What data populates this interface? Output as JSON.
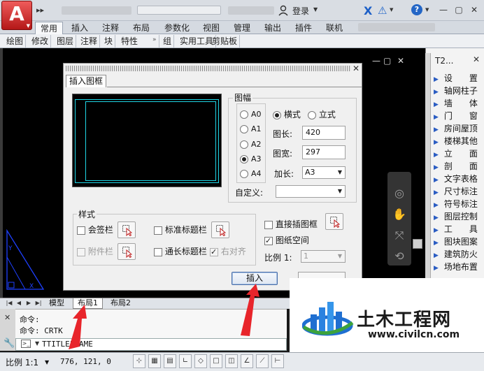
{
  "titlebar": {
    "qat_more": "▸▸",
    "login": "登录",
    "window_buttons": {
      "min": "—",
      "max": "▢",
      "close": "✕"
    }
  },
  "ribbon": {
    "tabs": [
      "常用",
      "插入",
      "注释",
      "布局",
      "参数化",
      "视图",
      "管理",
      "输出",
      "插件",
      "联机"
    ],
    "active_tab": 0,
    "panels": [
      "绘图",
      "修改",
      "图层",
      "注释",
      "块",
      "特性",
      "组",
      "实用工具",
      "剪贴板"
    ]
  },
  "drawing_window": {
    "min": "—",
    "max": "▢",
    "close": "✕"
  },
  "palette": {
    "title": "T2...",
    "close": "✕",
    "items": [
      "设　　置",
      "轴网柱子",
      "墙　　体",
      "门　　窗",
      "房间屋顶",
      "楼梯其他",
      "立　　面",
      "剖　　面",
      "文字表格",
      "尺寸标注",
      "符号标注",
      "图层控制",
      "工　　具",
      "图块图案",
      "建筑防火",
      "场地布置"
    ]
  },
  "dialog": {
    "title": "插入图框",
    "close": "✕",
    "format_group": "图幅",
    "paper_sizes": [
      "A0",
      "A1",
      "A2",
      "A3",
      "A4"
    ],
    "selected_paper": "A3",
    "orientation": {
      "landscape": "横式",
      "portrait": "立式",
      "selected": "landscape"
    },
    "length_label": "图长:",
    "length_value": "420",
    "width_label": "图宽:",
    "width_value": "297",
    "extend_label": "加长:",
    "extend_value": "A3",
    "custom_label": "自定义:",
    "custom_value": "",
    "style_group": "样式",
    "opt_countersign": "会签栏",
    "opt_standard_title": "标准标题栏",
    "opt_attached": "附件栏",
    "opt_long_title": "通长标题栏",
    "opt_right_align": "右对齐",
    "opt_direct_insert": "直接插图框",
    "opt_paper_space": "图纸空间",
    "scale_label": "比例 1:",
    "scale_value": "1",
    "insert_button": "插入"
  },
  "layout_tabs": [
    "模型",
    "布局1",
    "布局2"
  ],
  "active_layout": 1,
  "command": {
    "lines": [
      "命令:",
      "命令: CRTK"
    ],
    "input": "TTITLEFRAME"
  },
  "status": {
    "scale": "比例 1:1",
    "coords": "776, 121, 0"
  },
  "watermark": {
    "title": "土木工程网",
    "url": "www.civilcn.com"
  },
  "colors": {
    "frame_cyan": "#1fd6e6",
    "arrow_red": "#e8252b",
    "logo_red": "#c62020",
    "watermark_blue": "#1f6fd1"
  }
}
